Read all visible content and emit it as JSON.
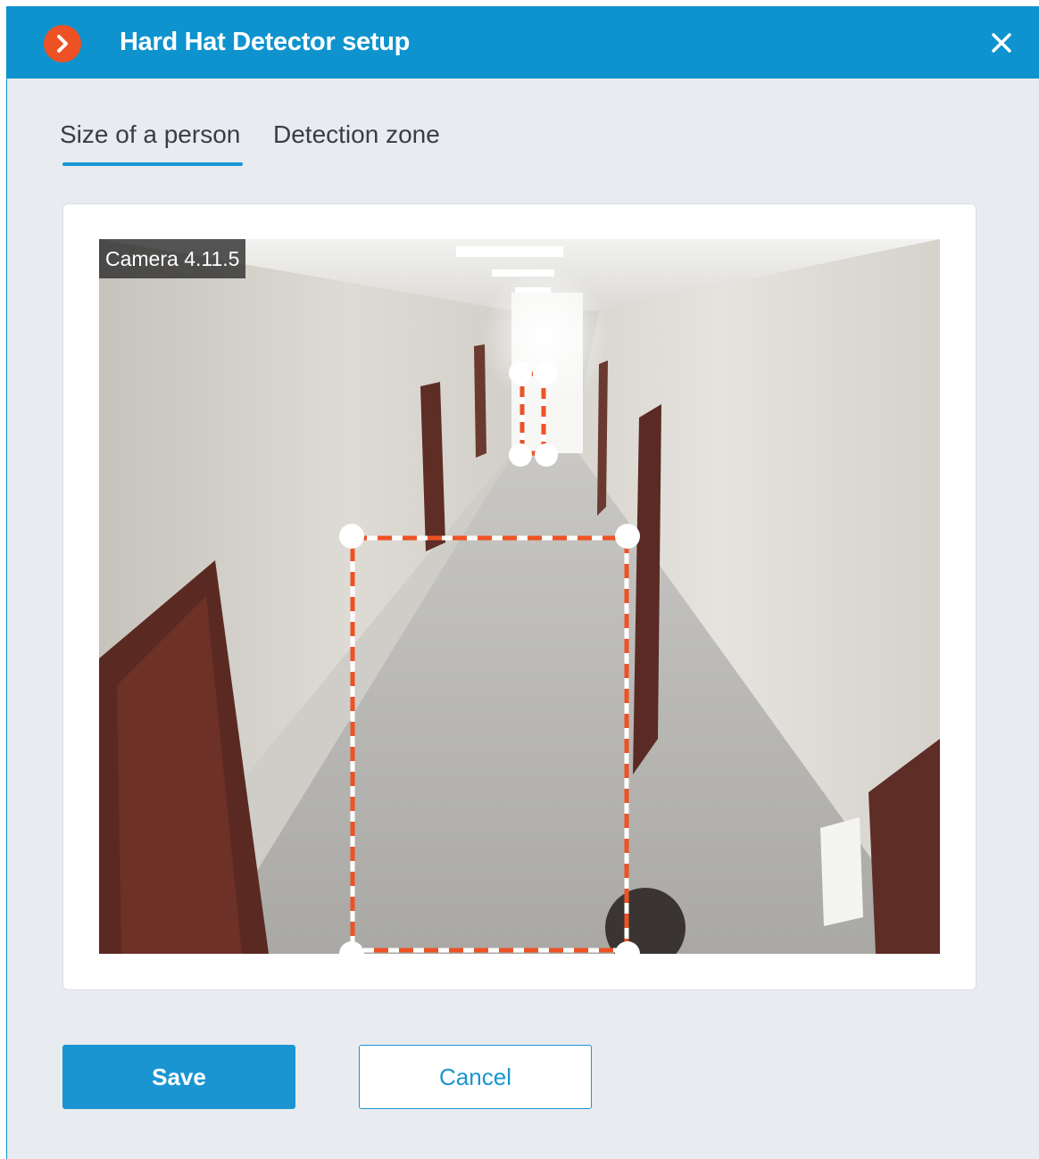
{
  "dialog": {
    "title": "Hard Hat Detector setup",
    "logo_icon": "chevron-right-circle-icon",
    "close_icon": "close-icon"
  },
  "tabs": [
    {
      "label": "Size of a person",
      "active": true
    },
    {
      "label": "Detection zone",
      "active": false
    }
  ],
  "video": {
    "camera_label": "Camera 4.11.5"
  },
  "buttons": {
    "save_label": "Save",
    "cancel_label": "Cancel"
  },
  "colors": {
    "accent": "#1a95d1",
    "titlebar": "#0e93ce",
    "logo": "#ee5224",
    "frame_dash": "#ee5224"
  }
}
